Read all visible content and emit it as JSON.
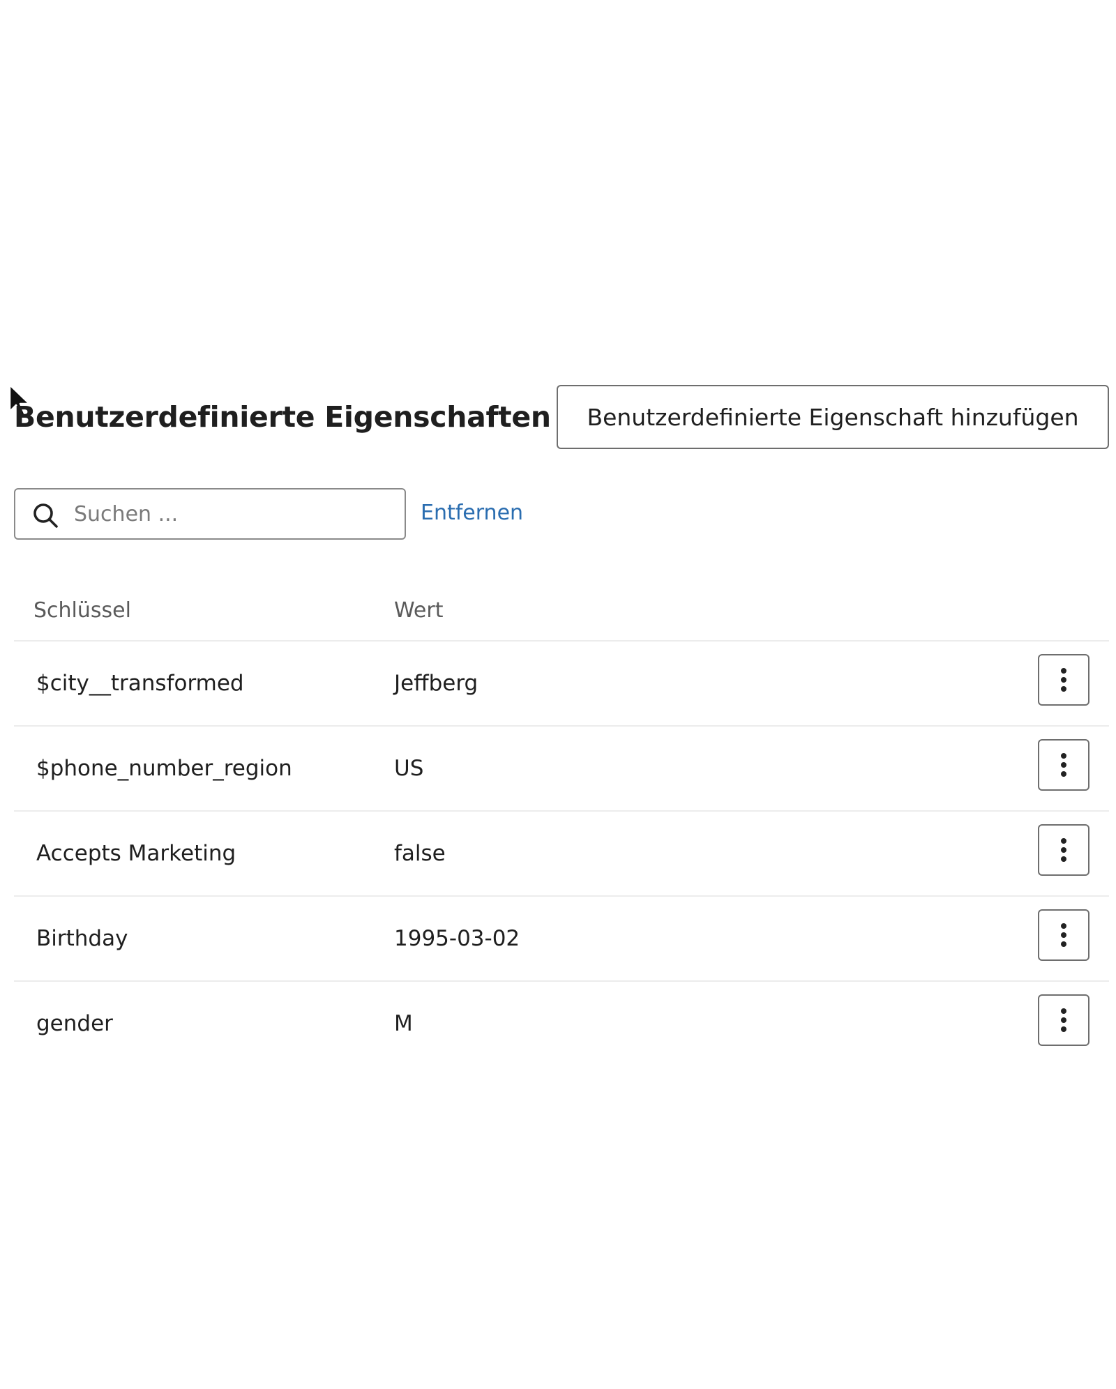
{
  "header": {
    "title": "Benutzerdefinierte Eigenschaften",
    "add_button_label": "Benutzerdefinierte Eigenschaft hinzufügen"
  },
  "search": {
    "placeholder": "Suchen ...",
    "value": "",
    "icon": "search-icon",
    "clear_label": "Entfernen"
  },
  "table": {
    "columns": [
      "Schlüssel",
      "Wert"
    ],
    "rows": [
      {
        "key": "$city__transformed",
        "value": "Jeffberg"
      },
      {
        "key": "$phone_number_region",
        "value": "US"
      },
      {
        "key": "Accepts Marketing",
        "value": "false"
      },
      {
        "key": "Birthday",
        "value": "1995-03-02"
      },
      {
        "key": "gender",
        "value": "M"
      }
    ],
    "row_action_icon": "more-vertical-icon"
  },
  "colors": {
    "text": "#1f1f1f",
    "muted_text": "#5a5a5a",
    "link": "#2a6db0",
    "border": "#6e6e6e",
    "divider": "#ececec"
  }
}
